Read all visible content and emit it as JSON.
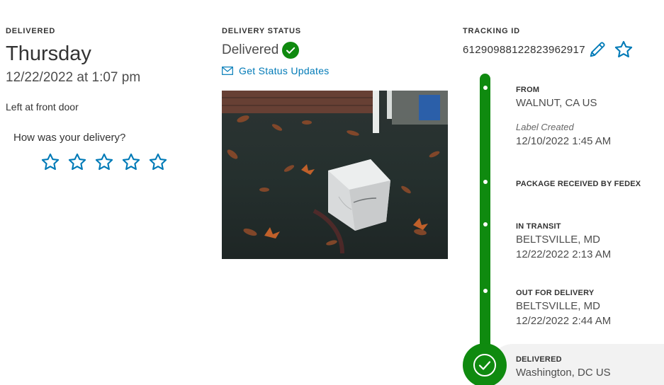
{
  "delivered_col": {
    "label": "DELIVERED",
    "day": "Thursday",
    "datetime": "12/22/2022 at 1:07 pm",
    "left_at": "Left at front door",
    "rating_question": "How was your delivery?",
    "stars": 5
  },
  "status_col": {
    "label": "DELIVERY STATUS",
    "status": "Delivered",
    "updates_link": "Get Status Updates"
  },
  "tracking_col": {
    "label": "TRACKING ID",
    "id": "612909881228239629​17"
  },
  "timeline": [
    {
      "title": "FROM",
      "line1": "WALNUT, CA US",
      "note": "Label Created",
      "line2": "12/10/2022 1:45 AM"
    },
    {
      "title": "PACKAGE RECEIVED BY FEDEX"
    },
    {
      "title": "IN TRANSIT",
      "line1": "BELTSVILLE, MD",
      "line2": "12/22/2022 2:13 AM"
    },
    {
      "title": "OUT FOR DELIVERY",
      "line1": "BELTSVILLE, MD",
      "line2": "12/22/2022 2:44 AM"
    },
    {
      "title": "DELIVERED",
      "line1": "Washington, DC US"
    }
  ],
  "colors": {
    "accent_blue": "#007ab7",
    "timeline_green": "#0f8a0f",
    "text": "#333333"
  },
  "icons": [
    "star-icon",
    "check-circle-icon",
    "mail-icon",
    "pencil-icon"
  ]
}
